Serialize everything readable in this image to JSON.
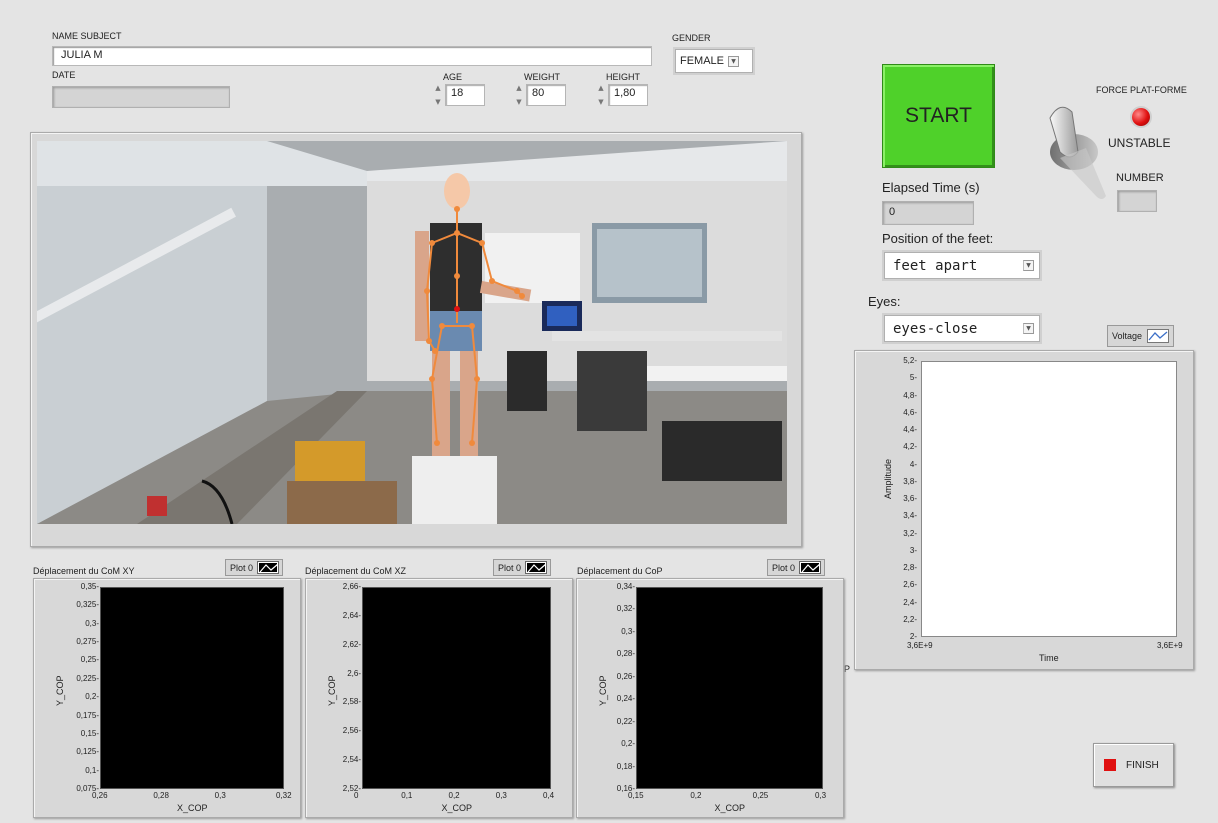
{
  "subject": {
    "name_label": "NAME SUBJECT",
    "name_value": "JULIA M",
    "date_label": "DATE",
    "date_value": "",
    "gender_label": "GENDER",
    "gender_value": "FEMALE",
    "age_label": "AGE",
    "age_value": "18",
    "weight_label": "WEIGHT",
    "weight_value": "80",
    "height_label": "HEIGHT",
    "height_value": "1,80"
  },
  "controls": {
    "start_label": "START",
    "force_label": "FORCE PLAT-FORME",
    "force_status": "UNSTABLE",
    "number_label": "NUMBER",
    "number_value": "",
    "elapsed_label": "Elapsed Time (s)",
    "elapsed_value": "0",
    "feet_label": "Position of the feet:",
    "feet_value": "feet apart",
    "eyes_label": "Eyes:",
    "eyes_value": "eyes-close",
    "finish_label": "FINISH",
    "led_color": "#e01010",
    "start_color": "#4fd12a"
  },
  "stray_text": "P",
  "voltage_chart": {
    "legend_label": "Voltage",
    "ylabel": "Amplitude",
    "xlabel": "Time",
    "xticks": [
      "3,6E+9",
      "3,6E+9"
    ],
    "yticks": [
      "2",
      "2,2",
      "2,4",
      "2,6",
      "2,8",
      "3",
      "3,2",
      "3,4",
      "3,6",
      "3,8",
      "4",
      "4,2",
      "4,4",
      "4,6",
      "4,8",
      "5",
      "5,2"
    ]
  },
  "chart_data": [
    {
      "type": "scatter",
      "title": "Déplacement du CoM XY",
      "legend": "Plot 0",
      "xlabel": "X_COP",
      "ylabel": "Y_COP",
      "xticks": [
        "0,26",
        "0,28",
        "0,3",
        "0,32"
      ],
      "yticks": [
        "0,075",
        "0,1",
        "0,125",
        "0,15",
        "0,175",
        "0,2",
        "0,225",
        "0,25",
        "0,275",
        "0,3",
        "0,325",
        "0,35"
      ],
      "xlim": [
        0.26,
        0.32
      ],
      "ylim": [
        0.075,
        0.35
      ],
      "series": []
    },
    {
      "type": "scatter",
      "title": "Déplacement du CoM XZ",
      "legend": "Plot 0",
      "xlabel": "X_COP",
      "ylabel": "Y_COP",
      "xticks": [
        "0",
        "0,1",
        "0,2",
        "0,3",
        "0,4"
      ],
      "yticks": [
        "2,52",
        "2,54",
        "2,56",
        "2,58",
        "2,6",
        "2,62",
        "2,64",
        "2,66"
      ],
      "xlim": [
        0,
        0.4
      ],
      "ylim": [
        2.52,
        2.66
      ],
      "series": []
    },
    {
      "type": "scatter",
      "title": "Déplacement du CoP",
      "legend": "Plot 0",
      "xlabel": "X_COP",
      "ylabel": "Y_COP",
      "xticks": [
        "0,15",
        "0,2",
        "0,25",
        "0,3"
      ],
      "yticks": [
        "0,16",
        "0,18",
        "0,2",
        "0,22",
        "0,24",
        "0,26",
        "0,28",
        "0,3",
        "0,32",
        "0,34"
      ],
      "xlim": [
        0.15,
        0.3
      ],
      "ylim": [
        0.16,
        0.34
      ],
      "series": []
    }
  ]
}
